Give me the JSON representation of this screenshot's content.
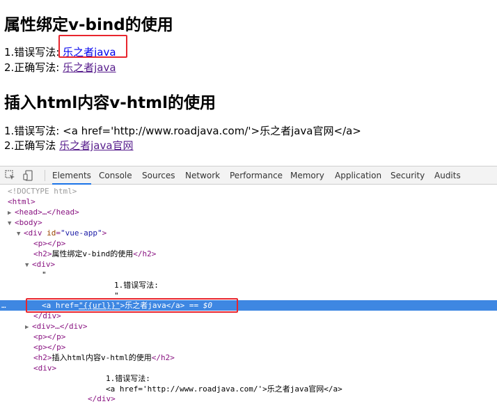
{
  "page": {
    "section1": {
      "title": "属性绑定v-bind的使用",
      "wrong_label": "1.错误写法: ",
      "wrong_link": "乐之者java",
      "right_label": "2.正确写法: ",
      "right_link": "乐之者java"
    },
    "section2": {
      "title": "插入html内容v-html的使用",
      "wrong_label": "1.错误写法: ",
      "wrong_raw": "<a href='http://www.roadjava.com/'>乐之者java官网</a>",
      "right_label": "2.正确写法 ",
      "right_link": "乐之者java官网"
    }
  },
  "devtools": {
    "tabs": [
      "Elements",
      "Console",
      "Sources",
      "Network",
      "Performance",
      "Memory",
      "Application",
      "Security",
      "Audits"
    ],
    "active_tab": "Elements",
    "icons": [
      "inspect-icon",
      "device-toggle-icon"
    ],
    "dom": {
      "doctype": "<!DOCTYPE html>",
      "html_open": "<html>",
      "head": "<head>…</head>",
      "body_open": "<body>",
      "div_open": "<div",
      "attr_id": "id",
      "attr_id_val": "\"vue-app\"",
      "p_empty": "<p></p>",
      "h2_open": "<h2>",
      "h2_close": "</h2>",
      "h2_text1": "属性绑定v-bind的使用",
      "div_tag": "<div>",
      "quote": "\"",
      "text_wrong": "1.错误写法: ",
      "quote2": "\"",
      "a_open": "<a",
      "attr_href": "href",
      "attr_href_val": "\"{{url}}\"",
      "a_text": "乐之者java",
      "a_close": "</a>",
      "eq0": " == $0",
      "div_close": "</div>",
      "div_collapsed": "<div>…</div>",
      "h2_text2": "插入html内容v-html的使用",
      "raw_text_wrong": "1.错误写法: ",
      "raw_a": "<a href='http://www.roadjava.com/'>乐之者java官网</a>",
      "ellipsis": "…"
    }
  }
}
